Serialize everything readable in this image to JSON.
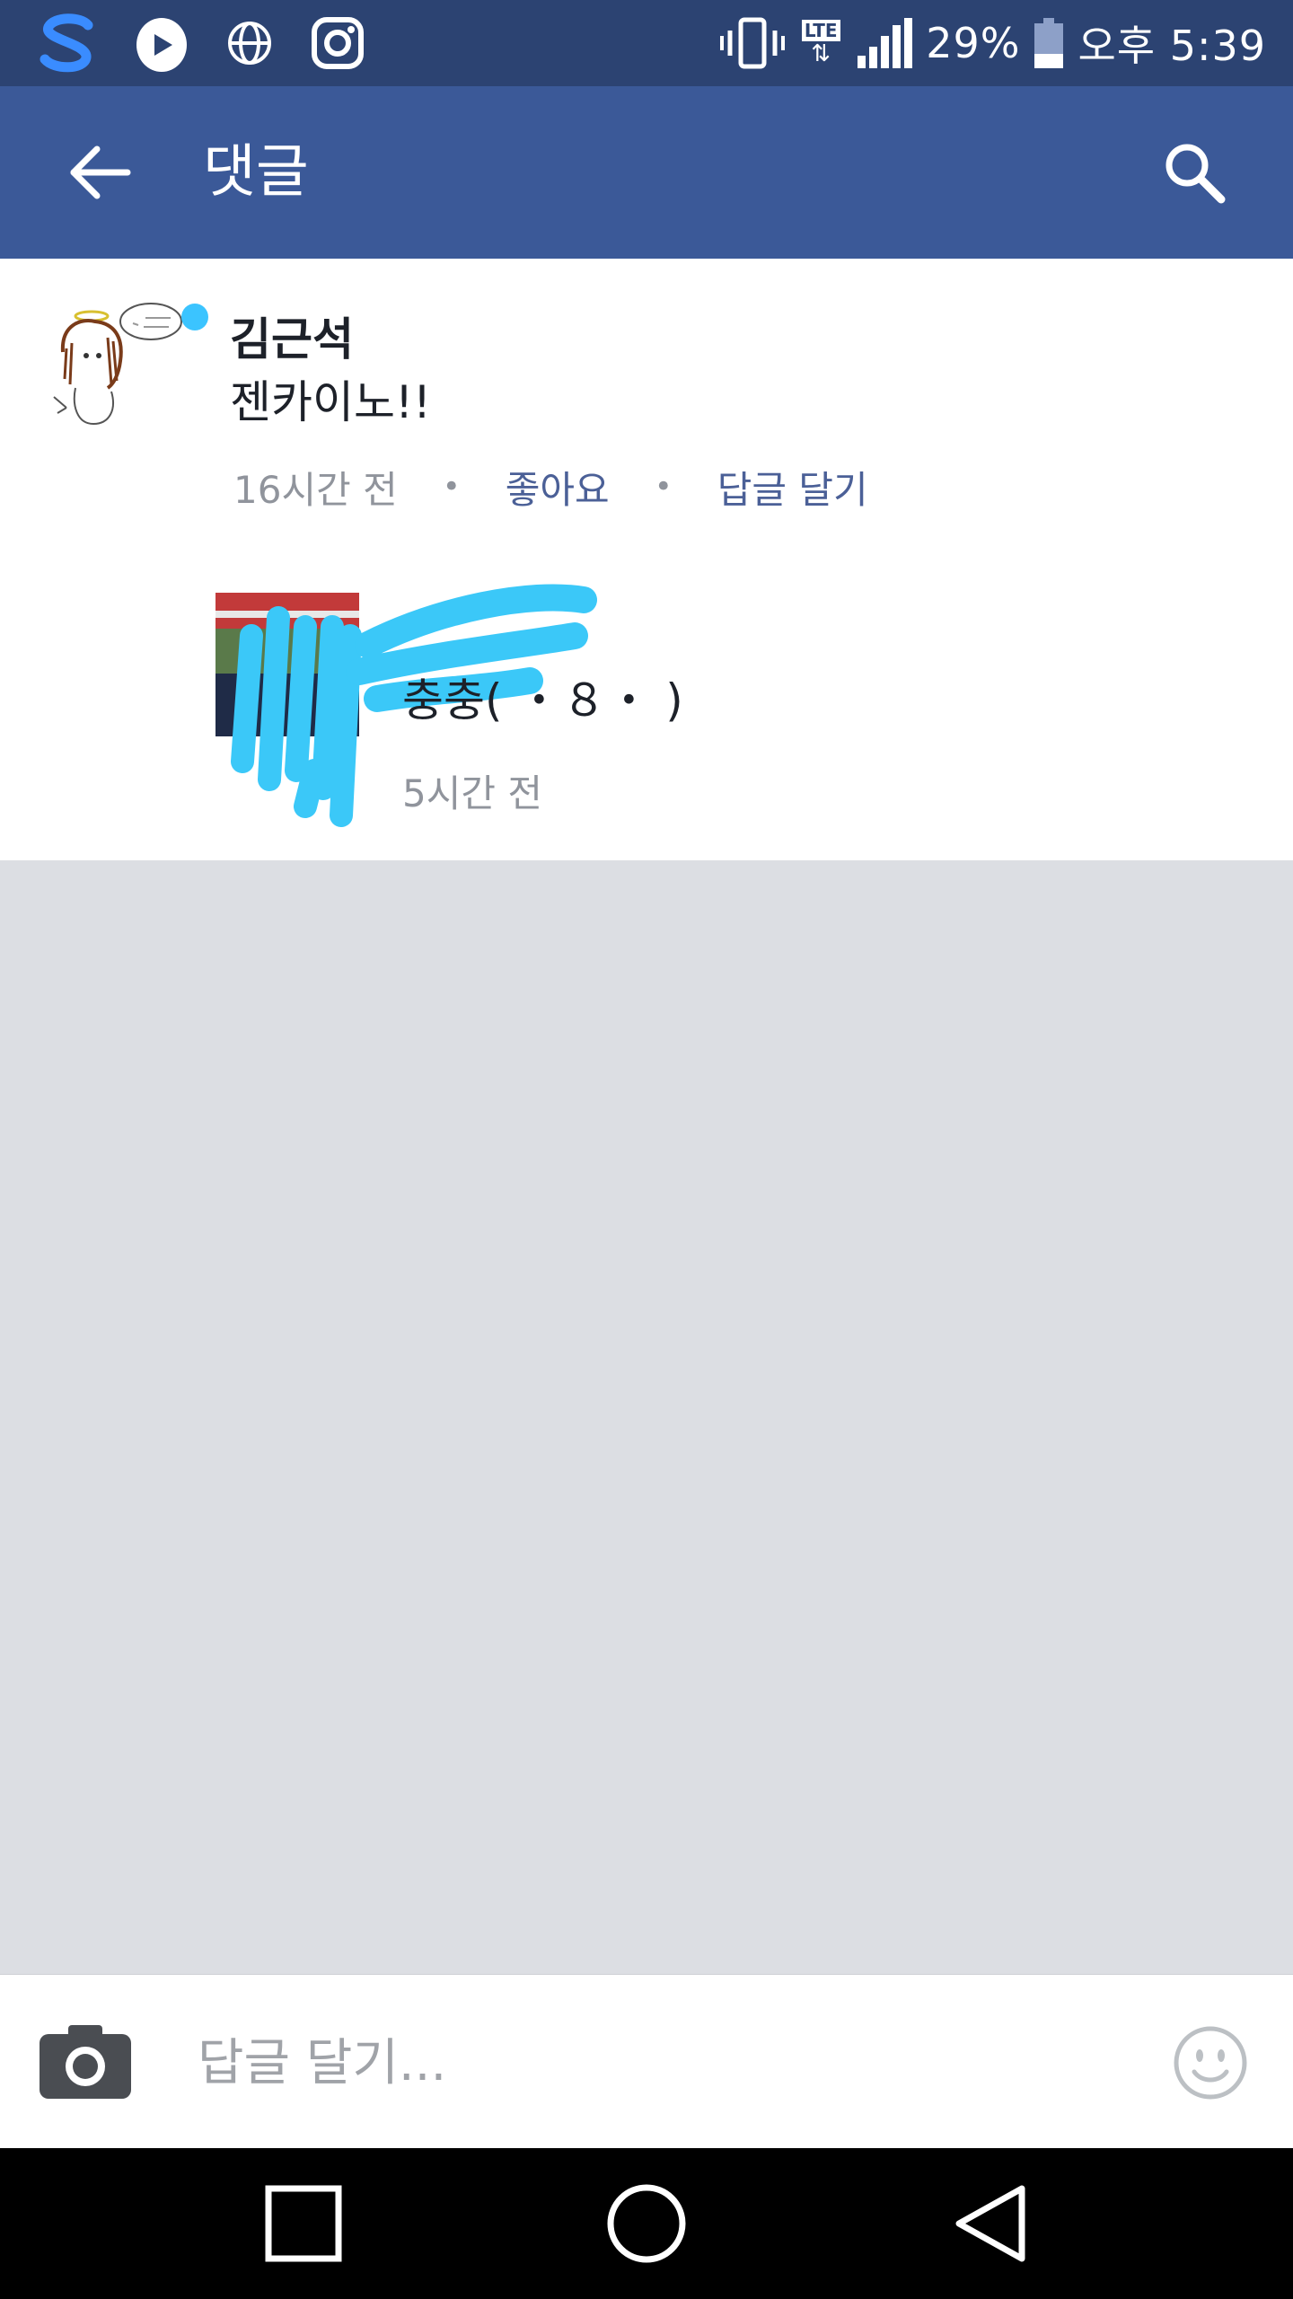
{
  "status_bar": {
    "battery_percent": "29%",
    "time": "오후 5:39",
    "network": "LTE",
    "notification_icons": [
      "s-app-icon",
      "play-egg-icon",
      "globe-icon",
      "instagram-icon"
    ]
  },
  "app_bar": {
    "title": "댓글",
    "back_icon": "arrow-left-icon",
    "search_icon": "search-icon"
  },
  "comment": {
    "author": "김근석",
    "text": "젠카이노!!",
    "time": "16시간 전",
    "like_label": "좋아요",
    "reply_label": "답글 달기",
    "online": true
  },
  "reply": {
    "text": "충충( ・８・ )",
    "time": "5시간 전"
  },
  "input_bar": {
    "placeholder": "답글 달기...",
    "camera_icon": "camera-icon",
    "emoji_icon": "smiley-icon"
  },
  "nav_bar": {
    "buttons": [
      "recents-square-icon",
      "home-circle-icon",
      "back-triangle-icon"
    ]
  },
  "colors": {
    "status_bar": "#2c4372",
    "app_bar": "#3b5998",
    "background": "#dcdee3",
    "link": "#4b6097",
    "meta": "#90949c",
    "online_dot": "#3bc4ff"
  }
}
